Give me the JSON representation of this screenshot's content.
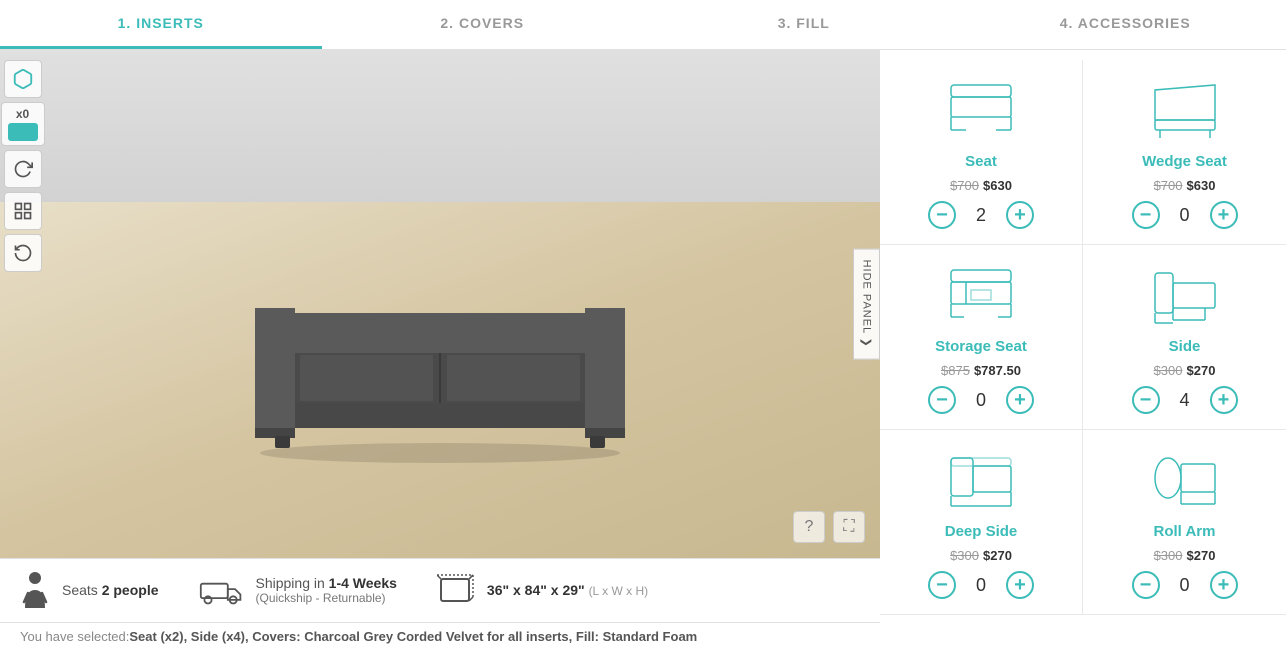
{
  "nav": {
    "items": [
      {
        "label": "1. INSERTS",
        "active": true
      },
      {
        "label": "2. COVERS",
        "active": false
      },
      {
        "label": "3. FILL",
        "active": false
      },
      {
        "label": "4. ACCESSORIES",
        "active": false
      }
    ]
  },
  "toolbar": {
    "x0_label": "x0",
    "rotate_icon": "↻",
    "grid_icon": "▦",
    "reset_icon": "↺"
  },
  "hide_panel": {
    "label": "HIDE PANEL",
    "chevron": "❯"
  },
  "info_bar": {
    "seats_label": "Seats",
    "seats_value": "2 people",
    "shipping_label": "Shipping in",
    "shipping_value": "1-4 Weeks",
    "shipping_sub": "(Quickship - Returnable)",
    "dimensions": "36\" x 84\" x 29\"",
    "dimensions_suffix": "(L x W x H)"
  },
  "selection_info": {
    "prefix": "You have selected:",
    "detail": " Seat (x2), Side (x4), Covers: Charcoal Grey Corded Velvet for all inserts, Fill: Standard Foam"
  },
  "inserts": [
    {
      "name": "Seat",
      "original_price": "$700",
      "sale_price": "$630",
      "quantity": 2
    },
    {
      "name": "Wedge Seat",
      "original_price": "$700",
      "sale_price": "$630",
      "quantity": 0
    },
    {
      "name": "Storage Seat",
      "original_price": "$875",
      "sale_price": "$787.50",
      "quantity": 0
    },
    {
      "name": "Side",
      "original_price": "$300",
      "sale_price": "$270",
      "quantity": 4
    },
    {
      "name": "Deep Side",
      "original_price": "$300",
      "sale_price": "$270",
      "quantity": 0
    },
    {
      "name": "Roll Arm",
      "original_price": "$300",
      "sale_price": "$270",
      "quantity": 0
    }
  ],
  "colors": {
    "teal": "#3bbcb8",
    "border": "#e0e0e0",
    "text_dark": "#333",
    "text_mid": "#555",
    "text_light": "#999"
  }
}
